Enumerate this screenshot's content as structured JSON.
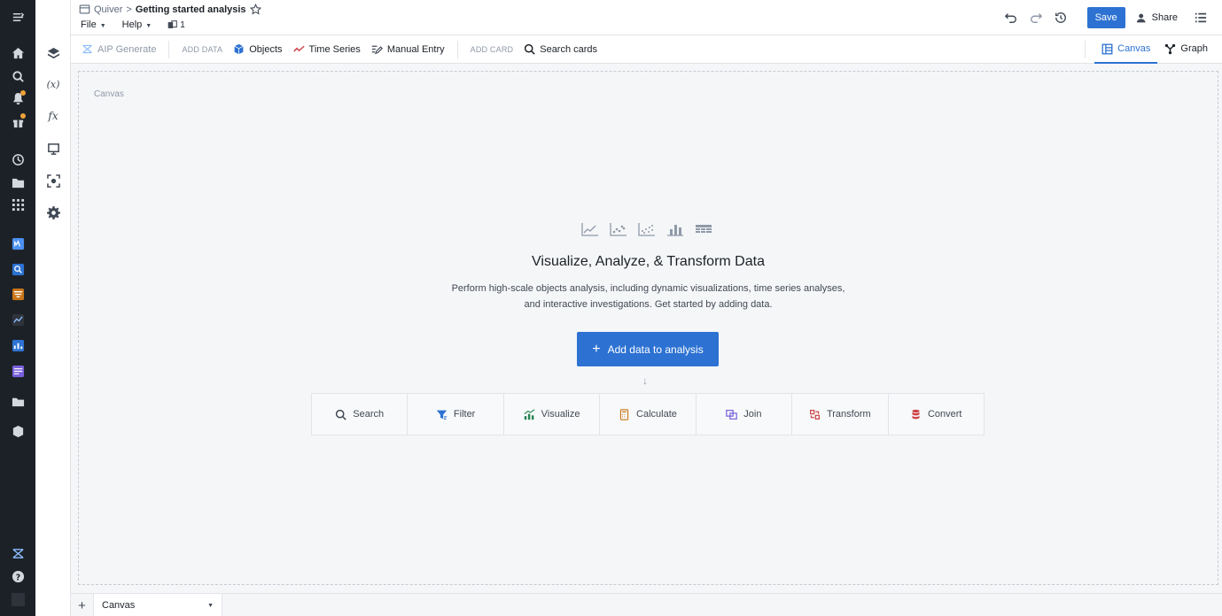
{
  "header": {
    "breadcrumb_app": "Quiver",
    "breadcrumb_sep": ">",
    "title": "Getting started analysis",
    "menus": [
      {
        "label": "File"
      },
      {
        "label": "Help"
      }
    ],
    "page_count": "1",
    "save_label": "Save",
    "share_label": "Share"
  },
  "toolbar": {
    "aip_generate": "AIP Generate",
    "add_data_section": "ADD DATA",
    "objects": "Objects",
    "time_series": "Time Series",
    "manual_entry": "Manual Entry",
    "add_card_section": "ADD CARD",
    "search_cards": "Search cards",
    "view_tabs": [
      {
        "label": "Canvas",
        "active": true
      },
      {
        "label": "Graph",
        "active": false
      }
    ]
  },
  "canvas": {
    "label": "Canvas",
    "headline": "Visualize, Analyze, & Transform Data",
    "description_line1": "Perform high-scale objects analysis, including dynamic visualizations, time series analyses,",
    "description_line2": "and interactive investigations. Get started by adding data.",
    "add_button": "Add data to analysis",
    "actions": [
      {
        "label": "Search",
        "icon": "search-icon",
        "color": "#404854"
      },
      {
        "label": "Filter",
        "icon": "filter-icon",
        "color": "#2d72d2"
      },
      {
        "label": "Visualize",
        "icon": "visualize-icon",
        "color": "#238551"
      },
      {
        "label": "Calculate",
        "icon": "calculate-icon",
        "color": "#c87619"
      },
      {
        "label": "Join",
        "icon": "join-icon",
        "color": "#7961db"
      },
      {
        "label": "Transform",
        "icon": "transform-icon",
        "color": "#cd4246"
      },
      {
        "label": "Convert",
        "icon": "convert-icon",
        "color": "#cd4246"
      }
    ]
  },
  "bottom": {
    "tab_label": "Canvas"
  },
  "colors": {
    "accent": "#2d72d2",
    "rail": "#1c2127",
    "notification": "#f0a33a"
  }
}
